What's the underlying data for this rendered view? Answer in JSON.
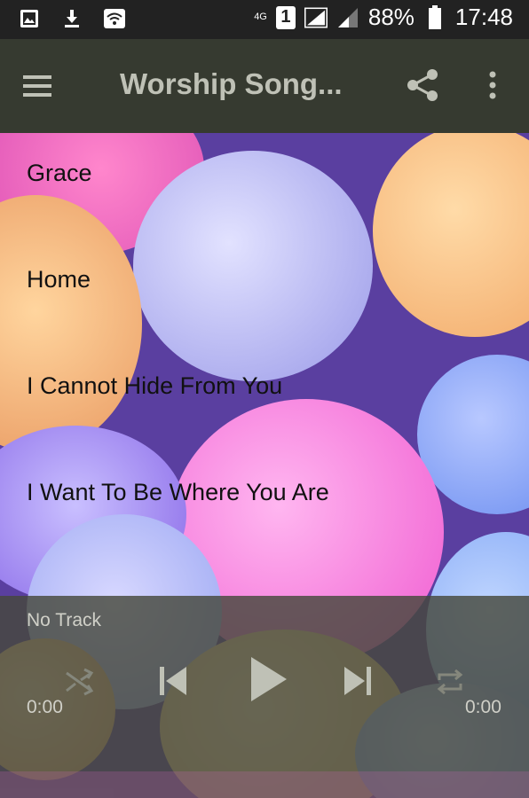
{
  "status_bar": {
    "network": "4G",
    "sim": "1",
    "battery": "88%",
    "time": "17:48"
  },
  "app_bar": {
    "title": "Worship Song..."
  },
  "songs": [
    {
      "title": "Grace"
    },
    {
      "title": "Home"
    },
    {
      "title": "I Cannot Hide From You"
    },
    {
      "title": "I Want To Be Where You Are"
    }
  ],
  "player": {
    "track": "No Track",
    "elapsed": "0:00",
    "duration": "0:00"
  },
  "colors": {
    "app_bar": "#363a30",
    "status_bar": "#222222",
    "title_text": "#bfc1b6",
    "player_bg": "#46483c"
  },
  "icons": [
    "image-icon",
    "download-icon",
    "wifi-icon",
    "signal-icon",
    "battery-icon",
    "menu-icon",
    "share-icon",
    "more-vert-icon",
    "shuffle-icon",
    "previous-icon",
    "play-icon",
    "next-icon",
    "repeat-icon"
  ]
}
